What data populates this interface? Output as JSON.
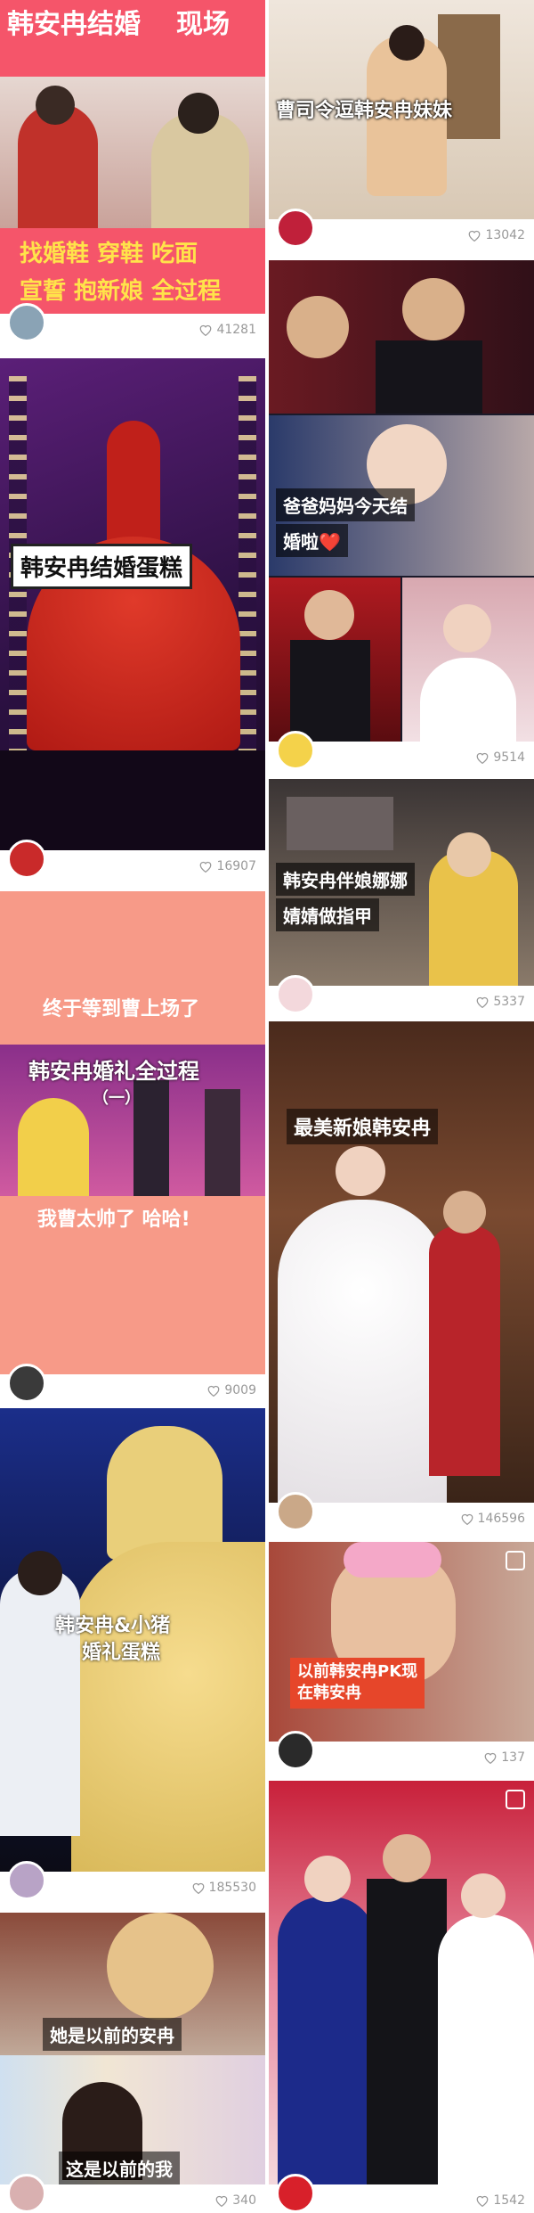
{
  "left": [
    {
      "captions": [
        "韩安冉结婚",
        "现场",
        "找婚鞋 穿鞋 吃面",
        "宣誓 抱新娘 全过程"
      ],
      "likes": "41281"
    },
    {
      "captions": [
        "韩安冉结婚蛋糕"
      ],
      "likes": "16907"
    },
    {
      "captions": [
        "终于等到曹上场了",
        "韩安冉婚礼全过程",
        "（一）",
        "我曹太帅了 哈哈!"
      ],
      "likes": "9009"
    },
    {
      "captions": [
        "韩安冉&小猪",
        "婚礼蛋糕"
      ],
      "likes": "185530"
    },
    {
      "captions": [
        "她是以前的安冉",
        "这是以前的我"
      ],
      "likes": "340"
    }
  ],
  "right": [
    {
      "captions": [
        "曹司令逗韩安冉妹妹"
      ],
      "likes": "13042"
    },
    {
      "captions": [
        "爸爸妈妈今天结",
        "婚啦❤️"
      ],
      "likes": "9514"
    },
    {
      "captions": [
        "韩安冉伴娘娜娜",
        "婧婧做指甲"
      ],
      "likes": "5337"
    },
    {
      "captions": [
        "最美新娘韩安冉"
      ],
      "likes": "146596"
    },
    {
      "captions": [
        "以前韩安冉PK现",
        "在韩安冉"
      ],
      "likes": "137"
    },
    {
      "captions": [],
      "likes": "1542"
    }
  ],
  "colors": {
    "pink": "#f5556a",
    "salmon": "#f79a88",
    "yellow": "#ffe34a",
    "like_gray": "#999999"
  }
}
